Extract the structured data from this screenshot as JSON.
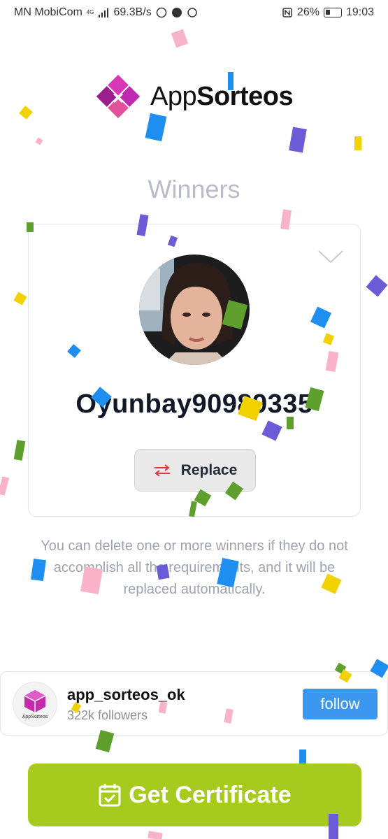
{
  "status_bar": {
    "carrier": "MN MobiCom",
    "network_type": "4G",
    "speed": "69.3B/s",
    "battery": "26%",
    "time": "19:03"
  },
  "logo": {
    "text_light": "App",
    "text_bold": "Sorteos"
  },
  "page": {
    "title": "Winners",
    "info_text": "You can delete one or more winners if they do not accomplish all the requirements, and it will be replaced automatically."
  },
  "winner": {
    "name": "Oyunbay90989335",
    "replace_label": "Replace"
  },
  "account": {
    "logo_caption": "AppSorteos",
    "handle": "app_sorteos_ok",
    "followers": "322k followers",
    "follow_label": "follow"
  },
  "certificate": {
    "label": "Get Certificate"
  },
  "colors": {
    "accent_green": "#a6cb1e",
    "follow_blue": "#3b97f0",
    "brand_magenta": "#b51fa0",
    "title_gray": "#b8bcc7"
  },
  "icons": {
    "expand": "chevron-down-icon",
    "replace": "swap-arrows-icon",
    "certificate": "calendar-check-icon"
  }
}
